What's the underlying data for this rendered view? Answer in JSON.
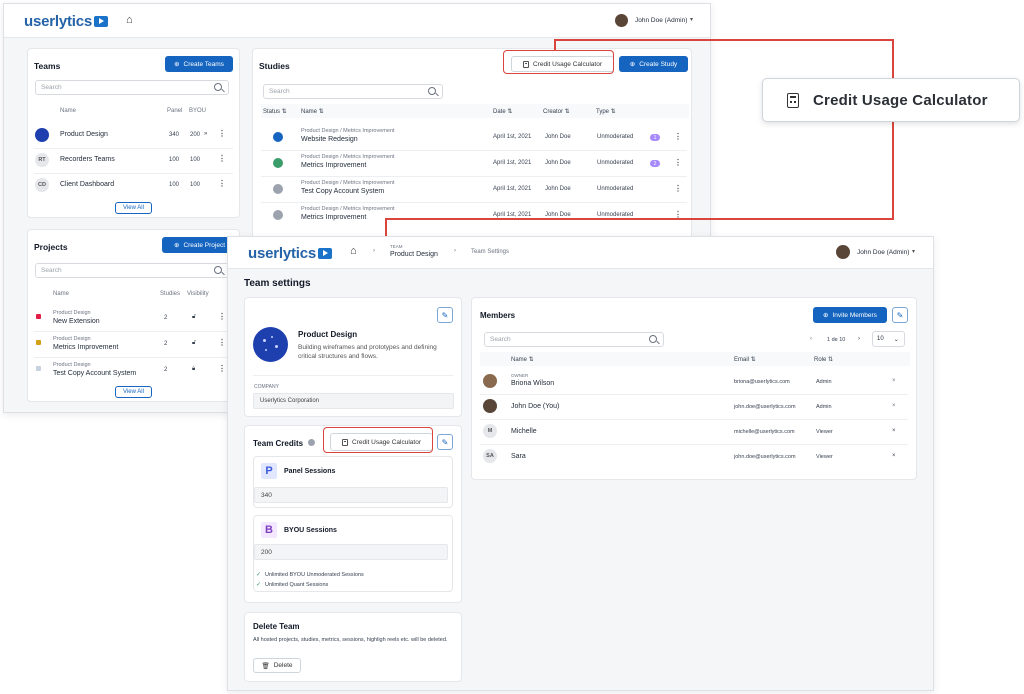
{
  "back_window": {
    "logo": "userlytics",
    "user": "John Doe (Admin)",
    "teams": {
      "title": "Teams",
      "create_label": "Create Teams",
      "search_placeholder": "Search",
      "headers": [
        "Name",
        "Panel",
        "BYOU"
      ],
      "rows": [
        {
          "initials": "",
          "name": "Product Design",
          "panel": "340",
          "byou": "200"
        },
        {
          "initials": "RT",
          "name": "Recorders Teams",
          "panel": "100",
          "byou": "100"
        },
        {
          "initials": "CD",
          "name": "Client Dashboard",
          "panel": "100",
          "byou": "100"
        }
      ],
      "view_all": "View All"
    },
    "projects": {
      "title": "Projects",
      "create_label": "Create Project",
      "search_placeholder": "Search",
      "headers": [
        "Name",
        "Studies",
        "Visibility"
      ],
      "rows": [
        {
          "crumb": "Product Design",
          "name": "New Extension",
          "studies": "2",
          "color": "#e11d48"
        },
        {
          "crumb": "Product Design",
          "name": "Metrics Improvement",
          "studies": "2",
          "color": "#d4a017"
        },
        {
          "crumb": "Product Design",
          "name": "Test Copy Account System",
          "studies": "2",
          "color": "#c7d2e0"
        }
      ],
      "view_all": "View All"
    },
    "studies": {
      "title": "Studies",
      "calc_label": "Credit Usage Calculator",
      "create_label": "Create Study",
      "search_placeholder": "Search",
      "headers": [
        "Status",
        "Name",
        "Date",
        "Creator",
        "Type"
      ],
      "rows": [
        {
          "crumb": "Product Design / Metrics Improvement",
          "name": "Website Redesign",
          "date": "April 1st, 2021",
          "creator": "John Doe",
          "type": "Unmoderated",
          "badge": "1",
          "status_color": "#1565c0"
        },
        {
          "crumb": "Product Design / Metrics Improvement",
          "name": "Metrics Improvement",
          "date": "April 1st, 2021",
          "creator": "John Doe",
          "type": "Unmoderated",
          "badge": "2",
          "status_color": "#3a9d6a"
        },
        {
          "crumb": "Product Design / Metrics Improvement",
          "name": "Test Copy Account System",
          "date": "April 1st, 2021",
          "creator": "John Doe",
          "type": "Unmoderated",
          "badge": "",
          "status_color": "#9ca3af"
        },
        {
          "crumb": "Product Design / Metrics Improvement",
          "name": "Metrics Improvement",
          "date": "April 1st, 2021",
          "creator": "John Doe",
          "type": "Unmoderated",
          "badge": "",
          "status_color": "#9ca3af"
        }
      ]
    }
  },
  "callout": {
    "label": "Credit Usage Calculator"
  },
  "front_window": {
    "logo": "userlytics",
    "breadcrumb": {
      "team_small": "TEAM",
      "team": "Product Design",
      "settings": "Team Settings"
    },
    "user": "John Doe (Admin)",
    "page_title": "Team settings",
    "team": {
      "name": "Product Design",
      "description": "Building wireframes and prototypes and defining critical structures and flows.",
      "company_label": "COMPANY",
      "company": "Userlytics Corporation"
    },
    "credits": {
      "title": "Team Credits",
      "calc_label": "Credit Usage Calculator",
      "panel": {
        "letter": "P",
        "title": "Panel Sessions",
        "value": "340"
      },
      "byou": {
        "letter": "B",
        "title": "BYOU Sessions",
        "value": "200",
        "checks": [
          "Unlimited BYOU Unmoderated Sessions",
          "Unlimited Quant Sessions"
        ]
      }
    },
    "delete": {
      "title": "Delete Team",
      "text": "All hosted projects, studies, metrics, sessions, highligh reels etc. will be deleted.",
      "button": "Delete"
    },
    "members": {
      "title": "Members",
      "invite_label": "Invite Members",
      "search_placeholder": "Search",
      "pagination": "1 de 10",
      "page_size": "10",
      "headers": [
        "Name",
        "Email",
        "Role"
      ],
      "rows": [
        {
          "tag": "OWNER",
          "name": "Briona Wilson",
          "email": "briona@userlytics.com",
          "role": "Admin",
          "initials": ""
        },
        {
          "tag": "",
          "name": "John Doe (You)",
          "email": "john.doe@userlytics.com",
          "role": "Admin",
          "initials": ""
        },
        {
          "tag": "",
          "name": "Michelle",
          "email": "michelle@userlytics.com",
          "role": "Viewer",
          "initials": "M"
        },
        {
          "tag": "",
          "name": "Sara",
          "email": "john.doe@userlytics.com",
          "role": "Viewer",
          "initials": "SA"
        }
      ]
    }
  }
}
